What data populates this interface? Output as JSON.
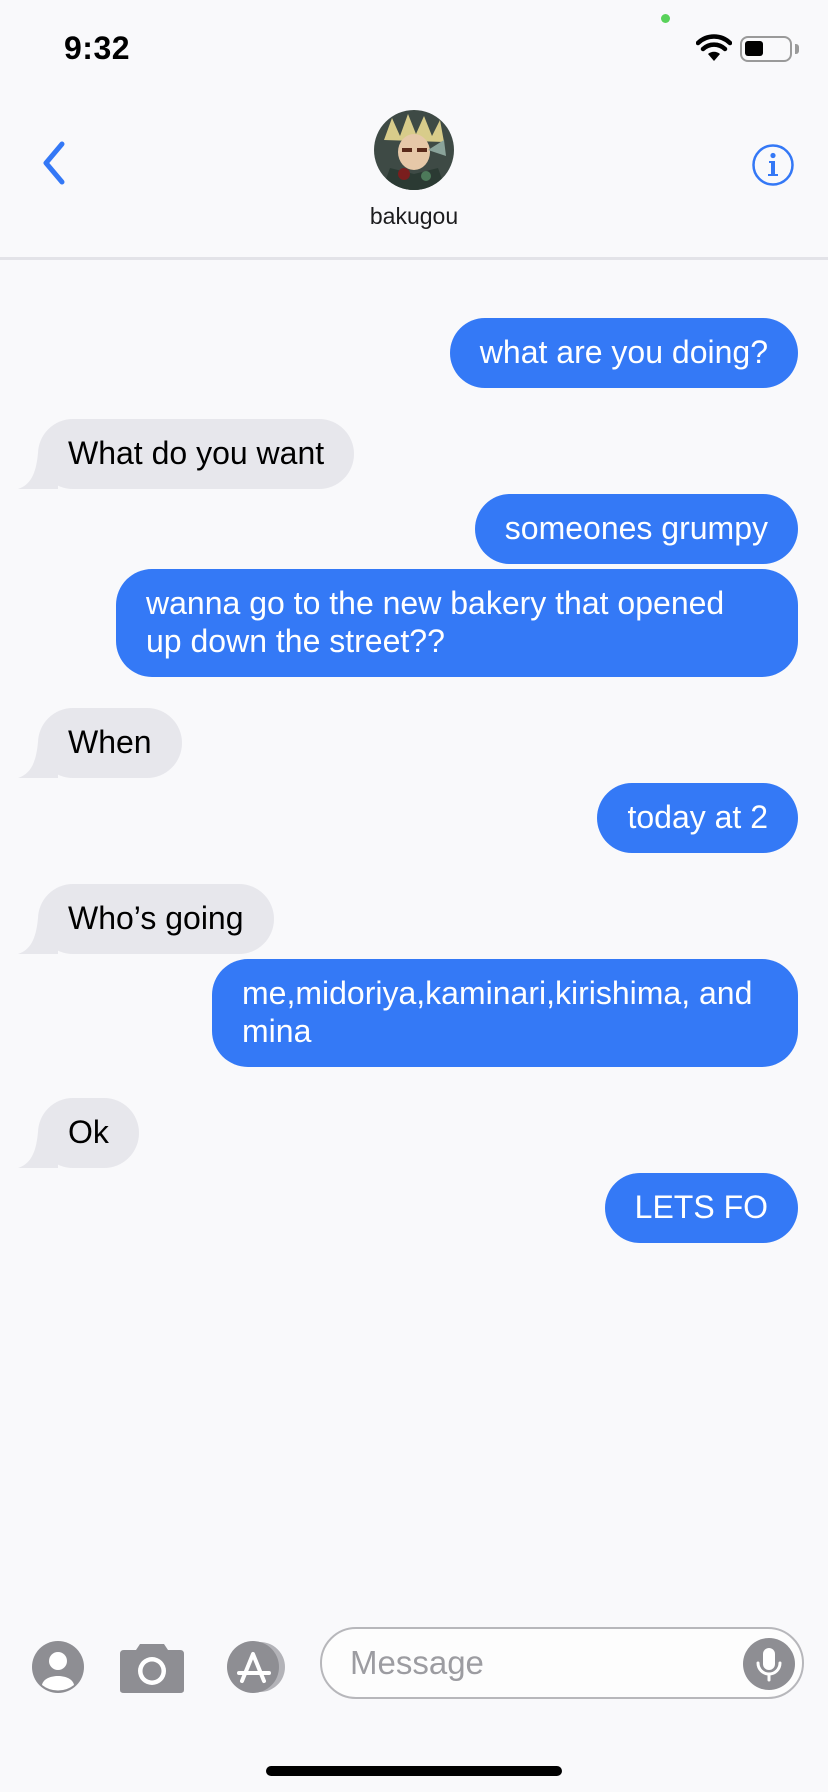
{
  "status_bar": {
    "time": "9:32",
    "battery_level": 0.45
  },
  "header": {
    "contact_name": "bakugou"
  },
  "messages": [
    {
      "from": "me",
      "text": "what are you doing?"
    },
    {
      "from": "them",
      "text": "What do you want"
    },
    {
      "from": "me",
      "text": "someones grumpy"
    },
    {
      "from": "me",
      "text": "wanna go to the new bakery that opened up down the street??"
    },
    {
      "from": "them",
      "text": "When"
    },
    {
      "from": "me",
      "text": "today at 2"
    },
    {
      "from": "them",
      "text": "Who’s going"
    },
    {
      "from": "me",
      "text": "me,midoriya,kaminari,kirishima, and mina"
    },
    {
      "from": "them",
      "text": "Ok"
    },
    {
      "from": "me",
      "text": "LETS FO"
    }
  ],
  "input": {
    "placeholder": "Message"
  },
  "colors": {
    "sent_bubble": "#3479f6",
    "received_bubble": "#e7e7ec",
    "accent": "#3478f6",
    "icon_gray": "#8e8e93"
  },
  "icons": [
    "back-chevron-icon",
    "info-icon",
    "contacts-icon",
    "camera-icon",
    "app-store-icon",
    "microphone-icon"
  ]
}
